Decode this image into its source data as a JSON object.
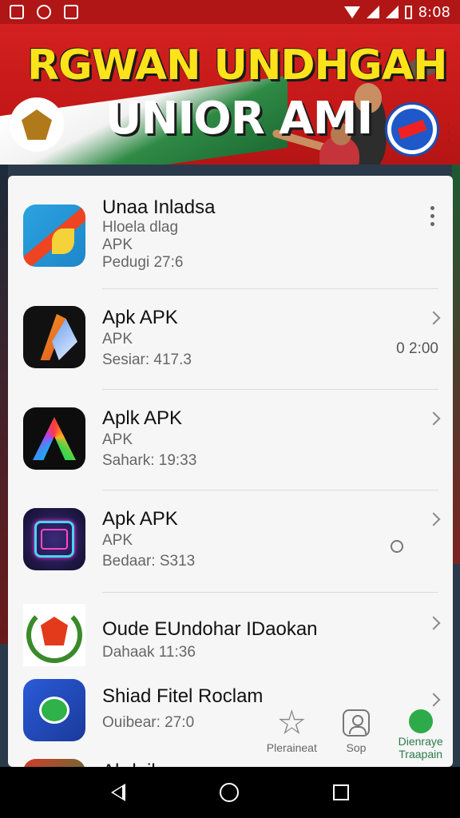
{
  "status_bar": {
    "time": "8:08"
  },
  "banner": {
    "title_line1": "RGWAN UNDHGAH",
    "title_line2": "UNIOR AMI"
  },
  "apps": [
    {
      "name": "Unaa Inladsa",
      "line1": "Hloela dlag",
      "line2": "APK",
      "line3": "Pedugi 27:6",
      "trailing": "menu"
    },
    {
      "name": "Apk APK",
      "line1": "APK",
      "line2": "Sesiar: 417.3",
      "time": "0 2:00",
      "trailing": "chevron"
    },
    {
      "name": "Aplk APK",
      "line1": "APK",
      "line2": "Sahark: 19:33",
      "trailing": "chevron"
    },
    {
      "name": "Apk APK",
      "line1": "APK",
      "line2": "Bedaar: S313",
      "trailing": "chevron",
      "status_icon": "sync-icon"
    },
    {
      "name": "Oude EUndohar IDaokan",
      "line1": "Dahaak 11:36",
      "trailing": "chevron"
    },
    {
      "name": "Shiad Fitel Roclam",
      "line1": "Ouibear: 27:0",
      "trailing": "chevron"
    },
    {
      "name": "Ahdaik",
      "trailing": "none"
    }
  ],
  "bottom_tabs": [
    {
      "label": "Pleraineat",
      "icon": "star-icon"
    },
    {
      "label": "Sop",
      "icon": "person-icon"
    },
    {
      "label": "Dienraye\nTraapain",
      "icon": "green-circle-icon",
      "active": true
    }
  ],
  "colors": {
    "status_bar": "#b01616",
    "banner_red": "#d42020",
    "banner_yellow": "#ffe31a",
    "accent_green": "#2dab4a"
  }
}
